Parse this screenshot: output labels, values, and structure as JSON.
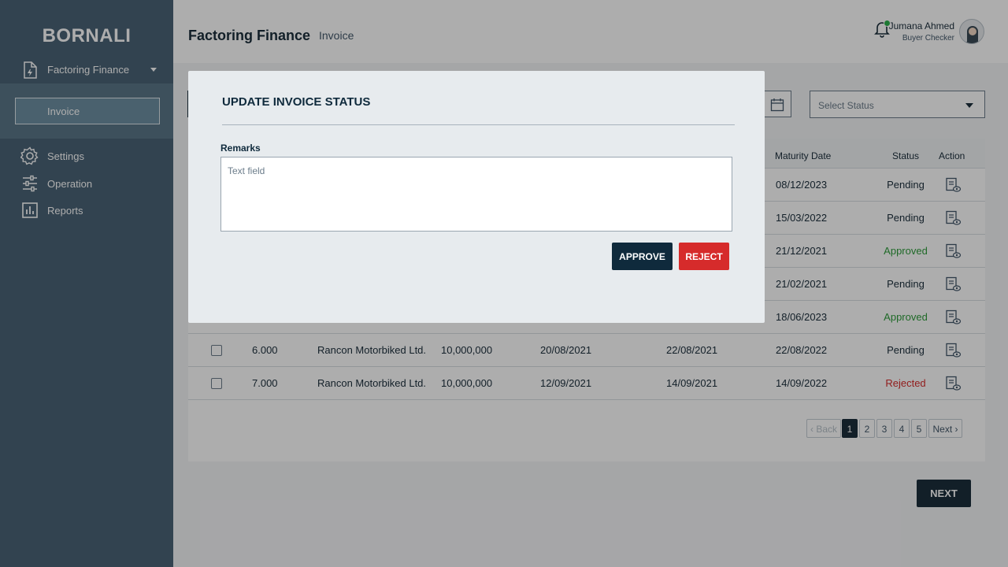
{
  "sidebar": {
    "brand": "BORNALI",
    "module": {
      "label": "Factoring Finance",
      "icon": "document-icon"
    },
    "sub_item": {
      "label": "Invoice"
    },
    "items": [
      {
        "label": "Settings",
        "icon": "gear-icon"
      },
      {
        "label": "Operation",
        "icon": "sliders-icon"
      },
      {
        "label": "Reports",
        "icon": "bar-chart-icon"
      }
    ]
  },
  "header": {
    "title": "Factoring Finance",
    "breadcrumb": "Invoice",
    "user": {
      "name": "Jumana Ahmed",
      "role": "Buyer Checker"
    }
  },
  "filters": {
    "status_placeholder": "Select Status"
  },
  "table": {
    "headers": {
      "maturity_date": "Maturity Date",
      "status": "Status",
      "action": "Action"
    },
    "rows": [
      {
        "maturity_date": "08/12/2023",
        "status": "Pending"
      },
      {
        "maturity_date": "15/03/2022",
        "status": "Pending"
      },
      {
        "maturity_date": "21/12/2021",
        "status": "Approved"
      },
      {
        "maturity_date": "21/02/2021",
        "status": "Pending"
      },
      {
        "maturity_date": "18/06/2023",
        "status": "Approved"
      },
      {
        "no": "6.000",
        "supplier": "Rancon Motorbiked Ltd.",
        "amount": "10,000,000",
        "invoice_date": "20/08/2021",
        "due_date": "22/08/2021",
        "maturity_date": "22/08/2022",
        "status": "Pending"
      },
      {
        "no": "7.000",
        "supplier": "Rancon Motorbiked Ltd.",
        "amount": "10,000,000",
        "invoice_date": "12/09/2021",
        "due_date": "14/09/2021",
        "maturity_date": "14/09/2022",
        "status": "Rejected"
      }
    ]
  },
  "pagination": {
    "back": "Back",
    "pages": [
      "1",
      "2",
      "3",
      "4",
      "5"
    ],
    "current": "1",
    "next": "Next"
  },
  "footer": {
    "next_button": "NEXT"
  },
  "modal": {
    "title": "UPDATE INVOICE STATUS",
    "remarks_label": "Remarks",
    "remarks_placeholder": "Text field",
    "approve_label": "APPROVE",
    "reject_label": "REJECT"
  },
  "colors": {
    "primary": "#0f2a3c",
    "approved": "#2e9c3b",
    "rejected": "#d62b2b",
    "sidebar": "#4a6376"
  }
}
